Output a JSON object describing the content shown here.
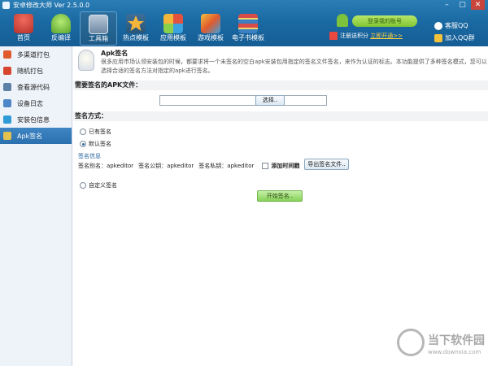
{
  "window": {
    "title": "安卓修改大师 Ver 2.5.0.0",
    "controls": [
      "–",
      "▢",
      "✕"
    ]
  },
  "nav": [
    {
      "label": "首页",
      "icon": "home-icon",
      "color": "#d9483b"
    },
    {
      "label": "反编译",
      "icon": "android-icon",
      "color": "#8bd04a"
    },
    {
      "label": "工具箱",
      "icon": "toolbox-icon",
      "color": "#8faac2"
    },
    {
      "label": "热点模板",
      "icon": "star-icon",
      "color": "#f4b63a"
    },
    {
      "label": "应用模板",
      "icon": "apps-icon",
      "color": "#e2523f"
    },
    {
      "label": "游戏模板",
      "icon": "game-icon",
      "color": "#f0c23e"
    },
    {
      "label": "电子书模板",
      "icon": "books-icon",
      "color": "#d74b49"
    }
  ],
  "account": {
    "login_button": "登录我的账号",
    "gift_text": "注册送积分",
    "gift_link": "立即开通>>"
  },
  "qq": {
    "service": "客服QQ",
    "group": "加入QQ群"
  },
  "sidebar": {
    "items": [
      {
        "label": "多渠道打包",
        "icon": "multi-channel-icon",
        "color": "#e05a2e"
      },
      {
        "label": "随机打包",
        "icon": "random-pack-icon",
        "color": "#d7462f"
      },
      {
        "label": "查看源代码",
        "icon": "source-code-icon",
        "color": "#5e7fa6"
      },
      {
        "label": "设备日志",
        "icon": "device-log-icon",
        "color": "#4f86c6"
      },
      {
        "label": "安装包信息",
        "icon": "package-info-icon",
        "color": "#2e9bd6"
      },
      {
        "label": "Apk签名",
        "icon": "apk-sign-icon",
        "color": "#e2c14f"
      }
    ],
    "active_index": 5
  },
  "main": {
    "title": "Apk签名",
    "description": "很多应用市场认领安装包的时候，都要求将一个未签名的空白apk安装包用指定的签名文件签名，来作为认证的标志。本功能提供了多种签名模式，您可以选择合适的签名方法对指定的apk进行签名。",
    "apk_section_label": "需要签名的APK文件：",
    "apk_path_value": "",
    "browse_button": "选择..",
    "method_label": "签名方式：",
    "options": {
      "existing": "已有签名",
      "default": "默认签名",
      "custom": "自定义签名"
    },
    "selected": "default",
    "sig_info_label": "签名信息",
    "sig_alias": "签名别名：apkeditor",
    "sig_pub": "签名公钥：apkeditor",
    "sig_priv": "签名私钥：apkeditor",
    "timestamp_label": "添加时间戳",
    "timestamp_checked": false,
    "export_button": "导出签名文件..",
    "start_button": "开始签名.."
  },
  "watermark": {
    "brand": "当下软件园",
    "url": "www.downxia.com"
  }
}
